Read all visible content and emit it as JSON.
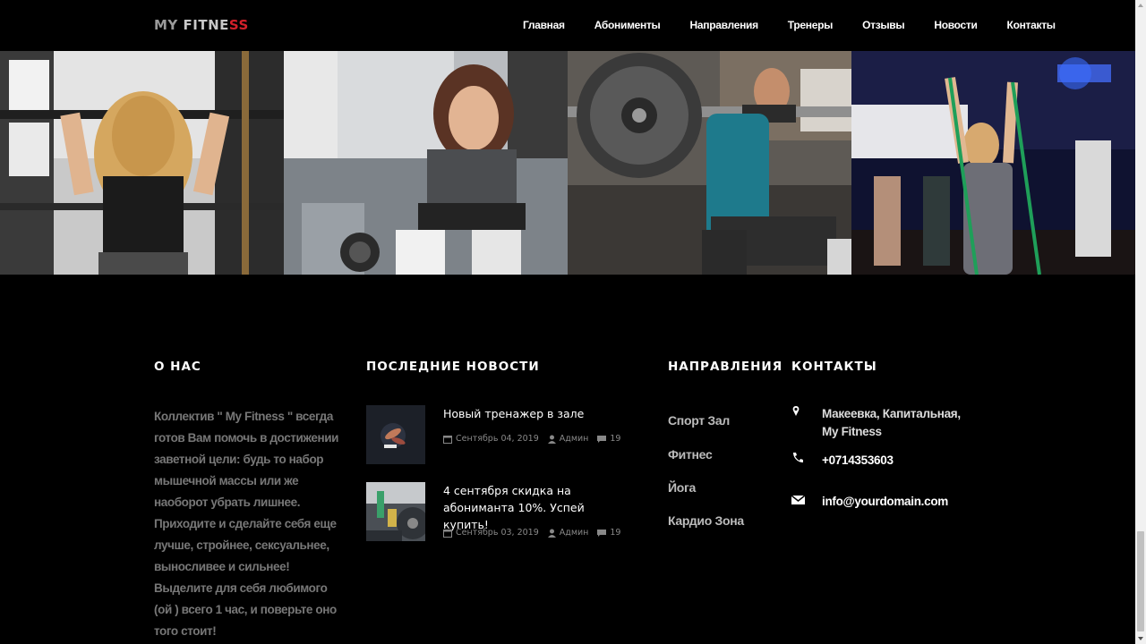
{
  "header": {
    "logo": {
      "part1": "MY ",
      "part2": "FITNE",
      "part3": "SS"
    },
    "nav": [
      "Главная",
      "Абонименты",
      "Направления",
      "Тренеры",
      "Отзывы",
      "Новости",
      "Контакты"
    ]
  },
  "footer": {
    "about": {
      "title": "О НАС",
      "text": "Коллектив \" My Fitness \" всегда готов Вам помочь в достижении заветной цели: будь то набор мышечной массы или же наоборот убрать лишнее. Приходите и сделайте себя еще лучше, стройнее, сексуальнее, выносливее и сильнее! Выделите для себя любимого (ой ) всего 1 час, и поверьте оно того стоит!"
    },
    "news": {
      "title": "ПОСЛЕДНИЕ НОВОСТИ",
      "items": [
        {
          "title": "Новый тренажер в зале",
          "date": "Сентябрь 04, 2019",
          "author": "Админ",
          "comments": "19"
        },
        {
          "title": "4 сентября скидка на абониманта 10%. Успей купить!",
          "date": "Сентябрь 03, 2019",
          "author": "Админ",
          "comments": "19"
        }
      ]
    },
    "directions": {
      "title": "НАПРАВЛЕНИЯ",
      "items": [
        "Спорт Зал",
        "Фитнес",
        "Йога",
        "Кардио Зона"
      ]
    },
    "contacts": {
      "title": "КОНТАКТЫ",
      "address": "Макеевка, Капитальная, My Fitness",
      "phone": "+0714353603",
      "email": "info@yourdomain.com"
    }
  },
  "colors": {
    "accent": "#d4202a",
    "background": "#000000",
    "muted_text": "#777777"
  }
}
